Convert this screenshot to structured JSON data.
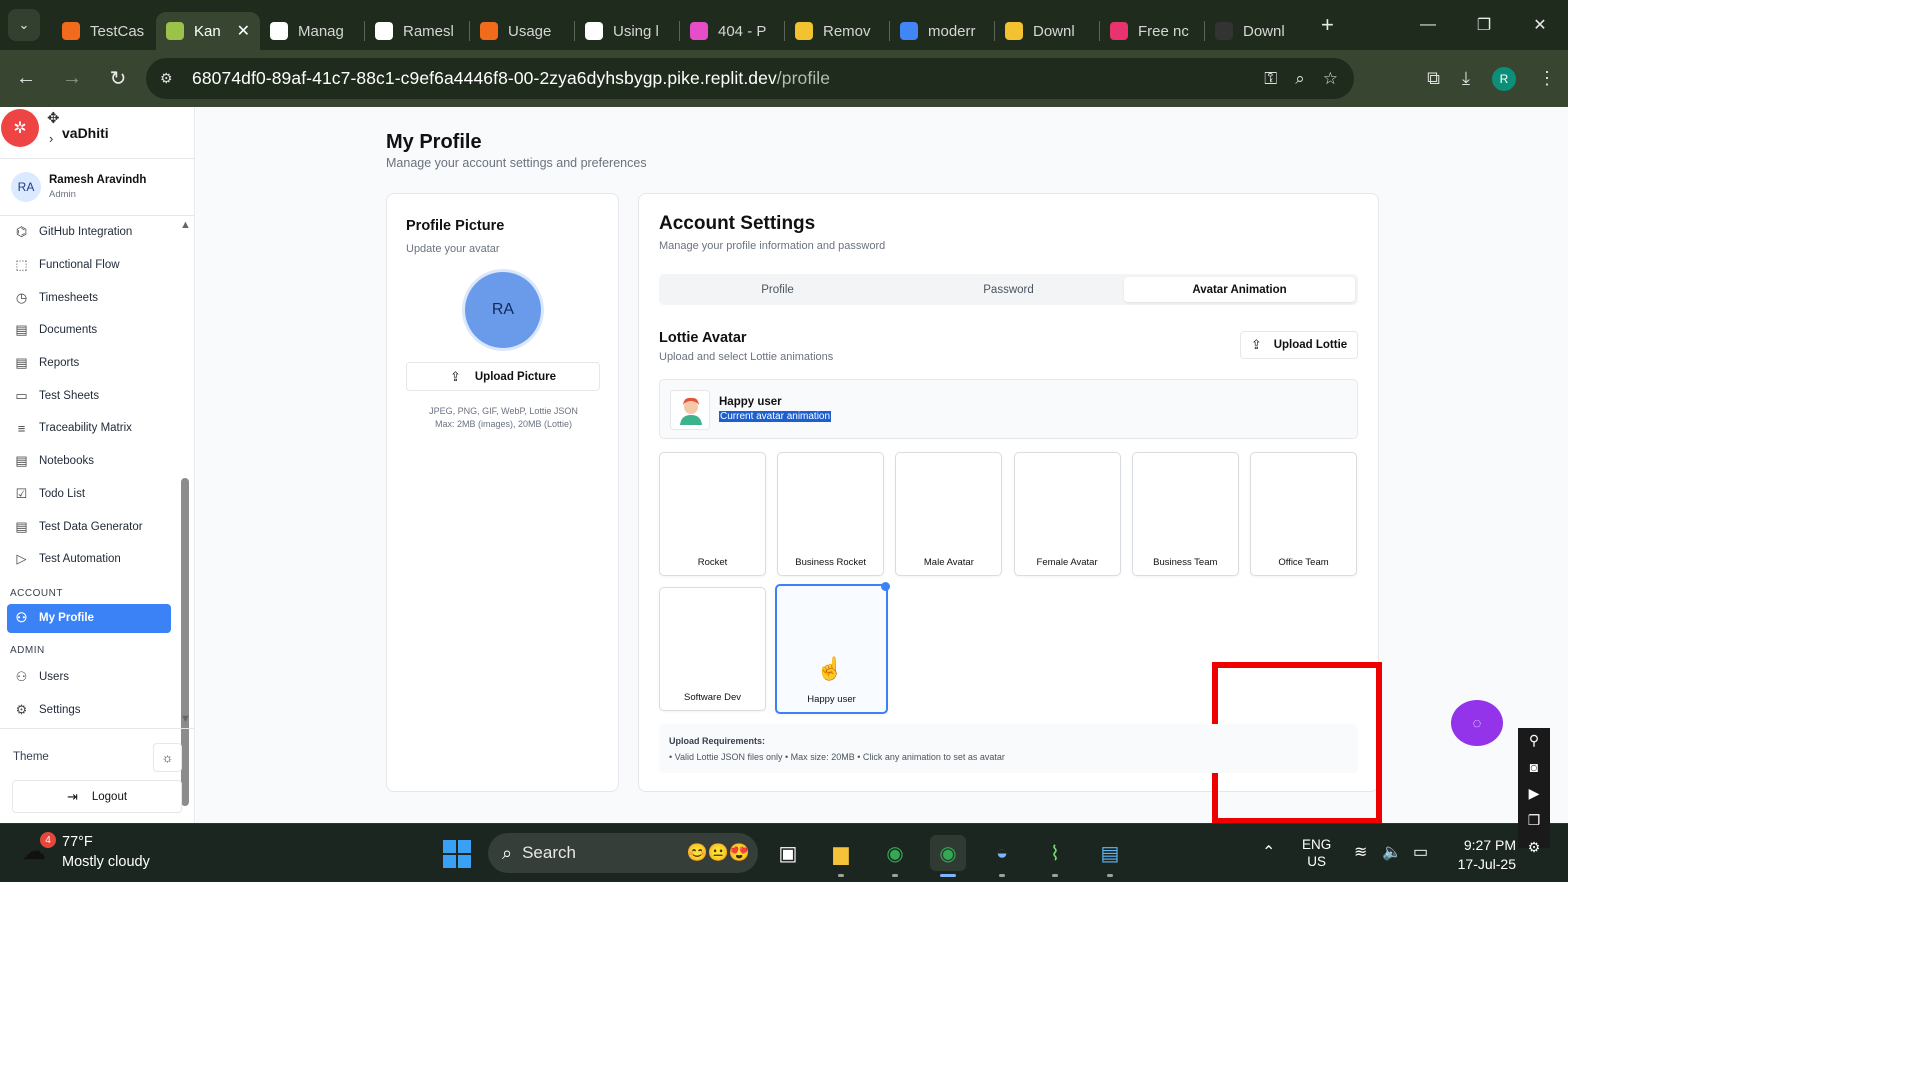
{
  "browser": {
    "tabs": [
      {
        "label": "TestCas",
        "fav_color": "#f26b1d"
      },
      {
        "label": "Kan",
        "fav_color": "#9bc34a",
        "active": true
      },
      {
        "label": "Manag",
        "fav_color": "#ffffff"
      },
      {
        "label": "Ramesl",
        "fav_color": "#ffffff"
      },
      {
        "label": "Usage",
        "fav_color": "#f26b1d"
      },
      {
        "label": "Using l",
        "fav_color": "#ffffff"
      },
      {
        "label": "404 - P",
        "fav_color": "#e64ec8"
      },
      {
        "label": "Remov",
        "fav_color": "#f2c230"
      },
      {
        "label": "moderr",
        "fav_color": "#4285f4"
      },
      {
        "label": "Downl",
        "fav_color": "#f2c230"
      },
      {
        "label": "Free nc",
        "fav_color": "#e8336f"
      },
      {
        "label": "Downl",
        "fav_color": "#333333"
      }
    ],
    "url_host": "68074df0-89af-41c7-88c1-c9ef6a4446f8-00-2zya6dyhsbygp.pike.replit.dev",
    "url_path": "/profile",
    "profile_initial": "R"
  },
  "sidebar": {
    "brand": "vaDhiti",
    "user": {
      "initials": "RA",
      "name": "Ramesh Aravindh",
      "role": "Admin"
    },
    "items": [
      {
        "label": "GitHub Integration",
        "icon": "github-icon",
        "glyph": "⌬"
      },
      {
        "label": "Functional Flow",
        "icon": "flow-icon",
        "glyph": "⬚"
      },
      {
        "label": "Timesheets",
        "icon": "clock-icon",
        "glyph": "◷"
      },
      {
        "label": "Documents",
        "icon": "document-icon",
        "glyph": "▤"
      },
      {
        "label": "Reports",
        "icon": "report-icon",
        "glyph": "▤"
      },
      {
        "label": "Test Sheets",
        "icon": "sheet-icon",
        "glyph": "▭"
      },
      {
        "label": "Traceability Matrix",
        "icon": "filter-icon",
        "glyph": "≡"
      },
      {
        "label": "Notebooks",
        "icon": "notebook-icon",
        "glyph": "▤"
      },
      {
        "label": "Todo List",
        "icon": "checkbox-icon",
        "glyph": "☑"
      },
      {
        "label": "Test Data Generator",
        "icon": "generator-icon",
        "glyph": "▤"
      },
      {
        "label": "Test Automation",
        "icon": "play-icon",
        "glyph": "▷"
      }
    ],
    "account_section": "ACCOUNT",
    "my_profile": "My Profile",
    "admin_section": "ADMIN",
    "admin_items": [
      {
        "label": "Users",
        "icon": "users-icon",
        "glyph": "⚇"
      },
      {
        "label": "Settings",
        "icon": "settings-icon",
        "glyph": "⚙"
      }
    ],
    "theme_label": "Theme",
    "logout_label": "Logout"
  },
  "page": {
    "title": "My Profile",
    "subtitle": "Manage your account settings and preferences"
  },
  "profile_picture": {
    "title": "Profile Picture",
    "subtitle": "Update your avatar",
    "avatar_initials": "RA",
    "upload_label": "Upload Picture",
    "hint_line1": "JPEG, PNG, GIF, WebP, Lottie JSON",
    "hint_line2": "Max: 2MB (images), 20MB (Lottie)"
  },
  "account": {
    "title": "Account Settings",
    "subtitle": "Manage your profile information and password",
    "tabs": [
      "Profile",
      "Password",
      "Avatar Animation"
    ],
    "active_tab": "Avatar Animation",
    "lottie_title": "Lottie Avatar",
    "lottie_subtitle": "Upload and select Lottie animations",
    "upload_lottie_label": "Upload Lottie",
    "current_name": "Happy user",
    "current_sub": "Current avatar animation",
    "animations": [
      "Rocket",
      "Business Rocket",
      "Male Avatar",
      "Female Avatar",
      "Business Team",
      "Office Team",
      "Software Dev",
      "Happy user"
    ],
    "selected_animation": "Happy user",
    "requirements_title": "Upload Requirements:",
    "requirements_text": "• Valid Lottie JSON files only • Max size: 20MB • Click any animation to set as avatar"
  },
  "taskbar": {
    "weather_badge": "4",
    "temperature": "77°F",
    "condition": "Mostly cloudy",
    "search_label": "Search",
    "lang_top": "ENG",
    "lang_bottom": "US",
    "time": "9:27 PM",
    "date": "17-Jul-25"
  }
}
